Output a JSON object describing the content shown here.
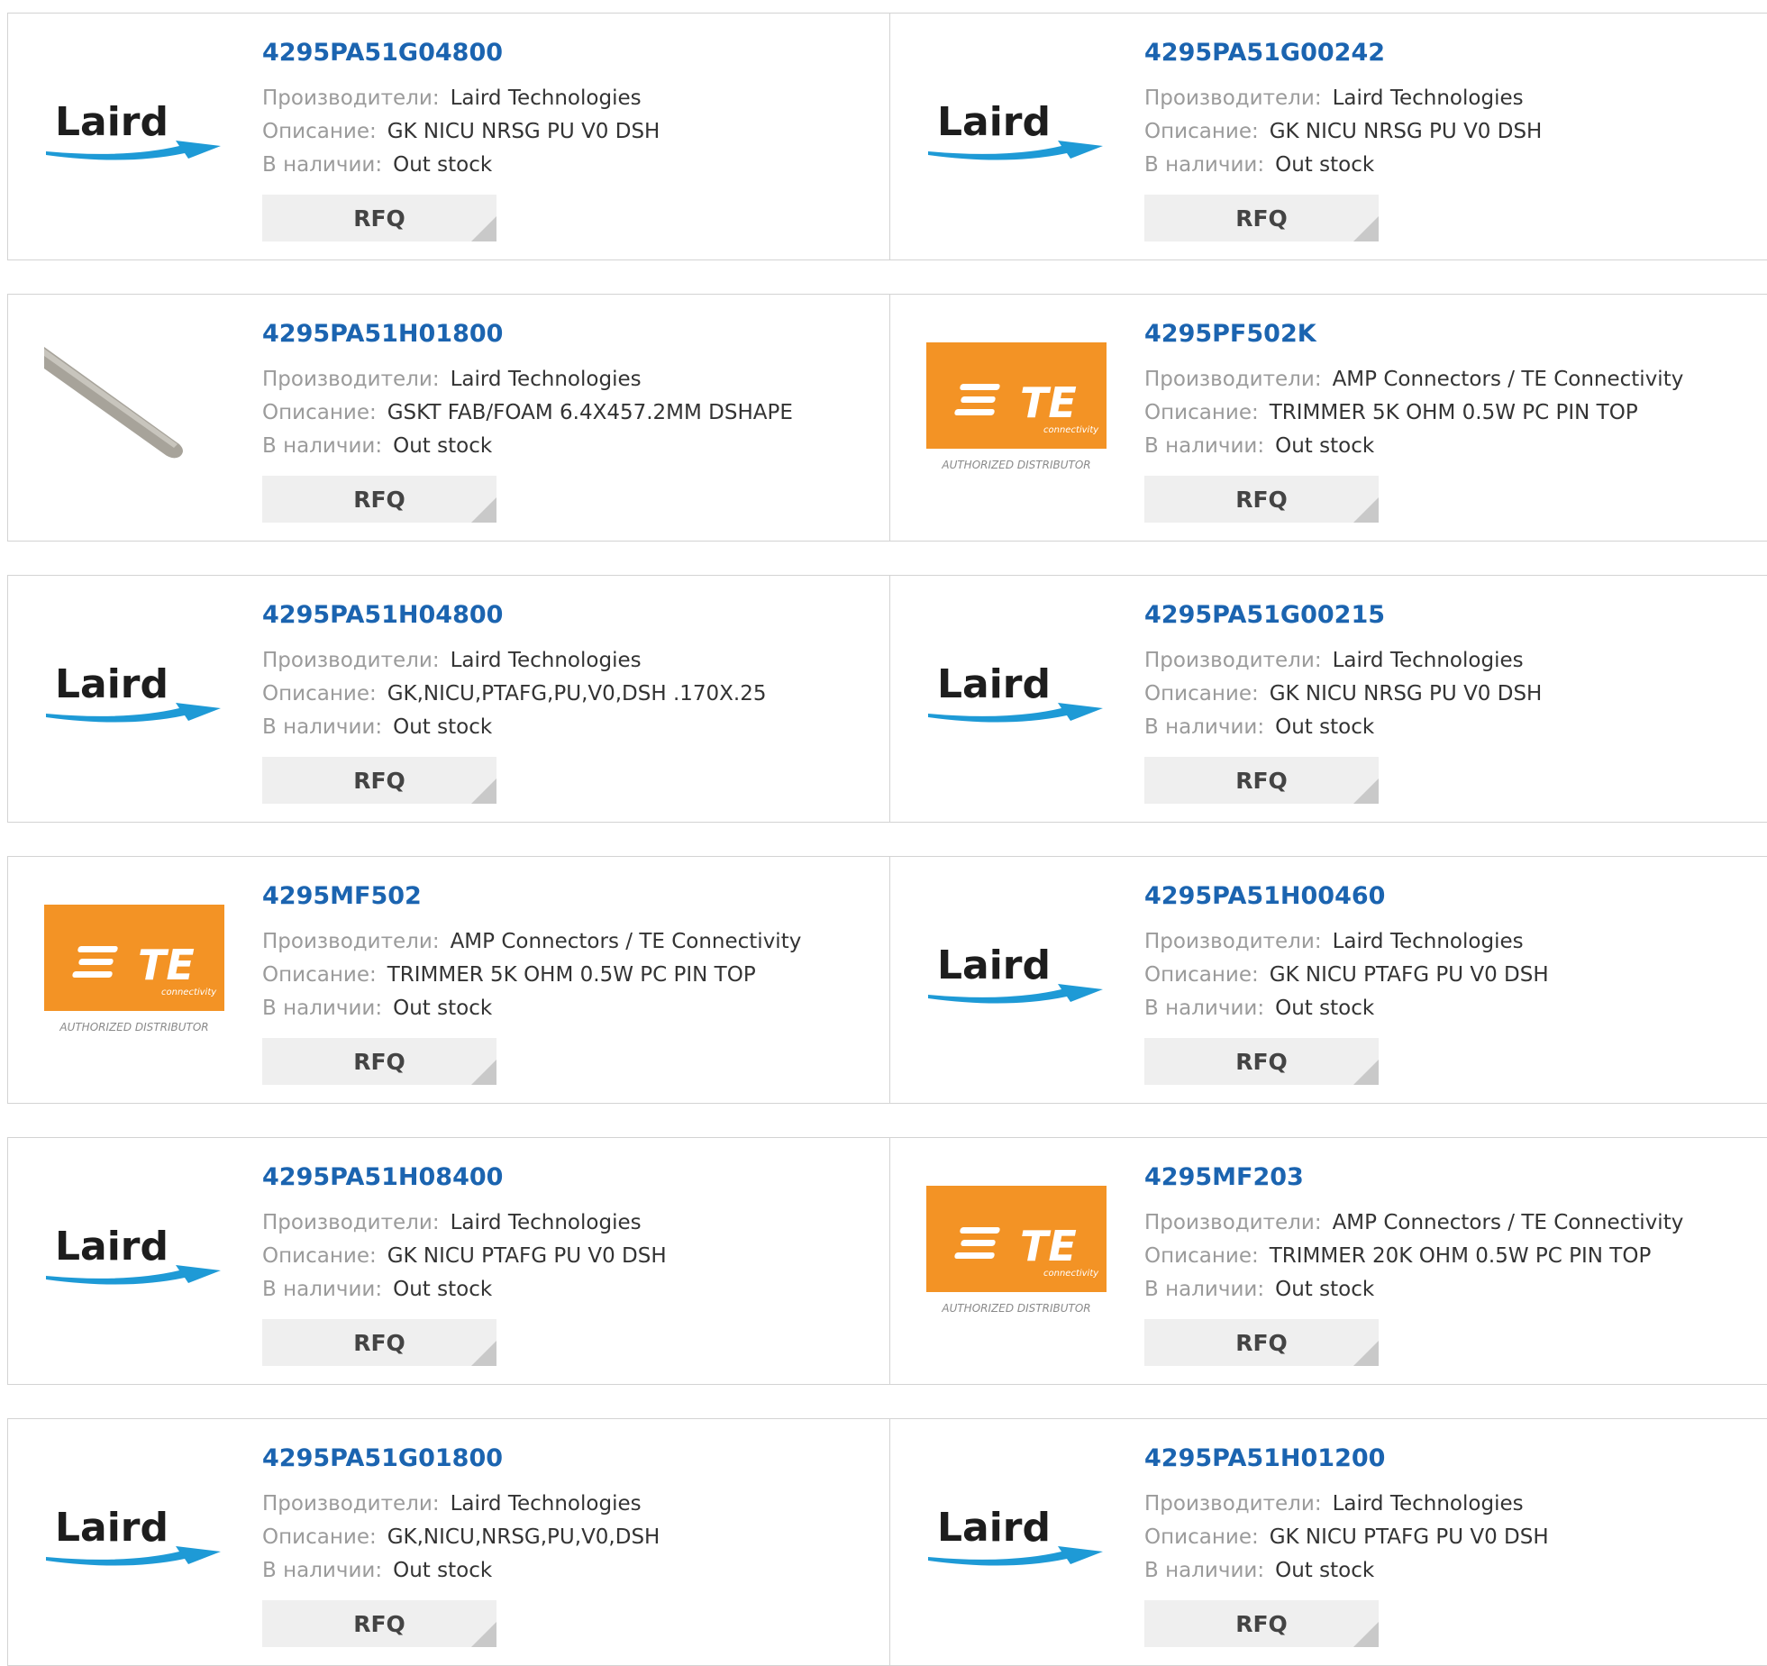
{
  "labels": {
    "manufacturer": "Производители:",
    "description": "Описание:",
    "stock": "В наличии:",
    "rfq": "RFQ"
  },
  "brand_logos": {
    "laird": {
      "text": "Laird",
      "color": "#1d1d1d",
      "swoosh": "#1e9ad6"
    },
    "te": {
      "text": "TE",
      "sub": "connectivity",
      "badge": "AUTHORIZED DISTRIBUTOR",
      "color": "#f39325"
    }
  },
  "products": [
    {
      "part": "4295PA51G04800",
      "image": "laird-logo",
      "manufacturer": "Laird Technologies",
      "description": "GK NICU NRSG PU V0 DSH",
      "stock": "Out stock"
    },
    {
      "part": "4295PA51G00242",
      "image": "laird-logo",
      "manufacturer": "Laird Technologies",
      "description": "GK NICU NRSG PU V0 DSH",
      "stock": "Out stock"
    },
    {
      "part": "4295PA51H01800",
      "image": "gasket-photo",
      "manufacturer": "Laird Technologies",
      "description": "GSKT FAB/FOAM 6.4X457.2MM DSHAPE",
      "stock": "Out stock"
    },
    {
      "part": "4295PF502K",
      "image": "te-logo",
      "manufacturer": "AMP Connectors / TE Connectivity",
      "description": "TRIMMER 5K OHM 0.5W PC PIN TOP",
      "stock": "Out stock"
    },
    {
      "part": "4295PA51H04800",
      "image": "laird-logo",
      "manufacturer": "Laird Technologies",
      "description": "GK,NICU,PTAFG,PU,V0,DSH .170X.25",
      "stock": "Out stock"
    },
    {
      "part": "4295PA51G00215",
      "image": "laird-logo",
      "manufacturer": "Laird Technologies",
      "description": "GK NICU NRSG PU V0 DSH",
      "stock": "Out stock"
    },
    {
      "part": "4295MF502",
      "image": "te-logo",
      "manufacturer": "AMP Connectors / TE Connectivity",
      "description": "TRIMMER 5K OHM 0.5W PC PIN TOP",
      "stock": "Out stock"
    },
    {
      "part": "4295PA51H00460",
      "image": "laird-logo",
      "manufacturer": "Laird Technologies",
      "description": "GK NICU PTAFG PU V0 DSH",
      "stock": "Out stock"
    },
    {
      "part": "4295PA51H08400",
      "image": "laird-logo",
      "manufacturer": "Laird Technologies",
      "description": "GK NICU PTAFG PU V0 DSH",
      "stock": "Out stock"
    },
    {
      "part": "4295MF203",
      "image": "te-logo",
      "manufacturer": "AMP Connectors / TE Connectivity",
      "description": "TRIMMER 20K OHM 0.5W PC PIN TOP",
      "stock": "Out stock"
    },
    {
      "part": "4295PA51G01800",
      "image": "laird-logo",
      "manufacturer": "Laird Technologies",
      "description": "GK,NICU,NRSG,PU,V0,DSH",
      "stock": "Out stock"
    },
    {
      "part": "4295PA51H01200",
      "image": "laird-logo",
      "manufacturer": "Laird Technologies",
      "description": "GK NICU PTAFG PU V0 DSH",
      "stock": "Out stock"
    }
  ]
}
